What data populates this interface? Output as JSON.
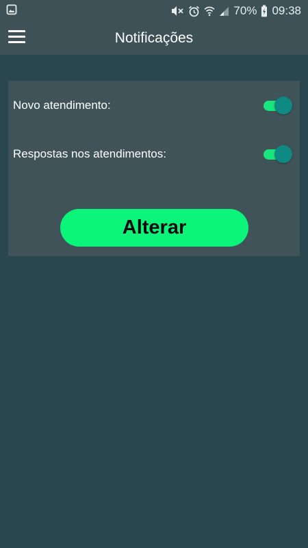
{
  "status_bar": {
    "battery_percent": "70%",
    "time": "09:38",
    "icons": [
      "gallery-notification-icon",
      "mute-icon",
      "alarm-icon",
      "wifi-icon",
      "cell-signal-icon",
      "battery-charging-icon"
    ]
  },
  "app_bar": {
    "title": "Notificações",
    "menu_icon": "hamburger-menu-icon"
  },
  "settings": {
    "items": [
      {
        "label": "Novo atendimento:",
        "enabled": true
      },
      {
        "label": "Respostas nos atendimentos:",
        "enabled": true
      }
    ],
    "submit_label": "Alterar"
  },
  "colors": {
    "background": "#2a4750",
    "bar": "#3d5156",
    "card": "#3f5358",
    "switch_track": "#18e57b",
    "switch_thumb": "#0f8a82",
    "button": "#0bf57b"
  }
}
